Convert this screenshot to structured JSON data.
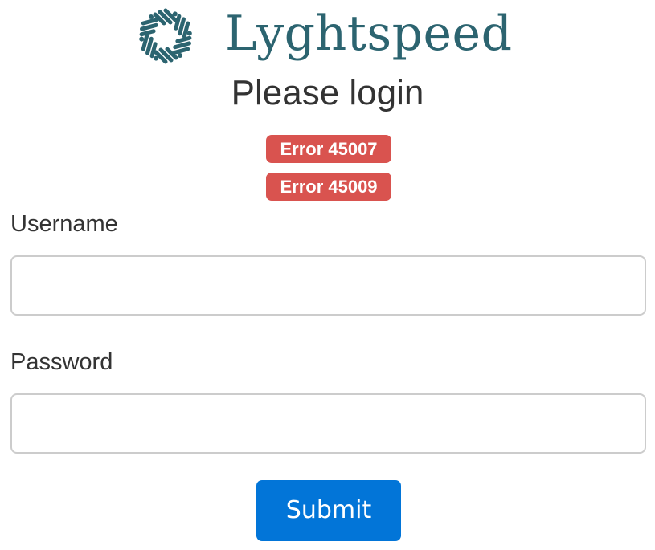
{
  "brand": {
    "name": "Lyghtspeed",
    "logo_icon": "circuit-ring-logo",
    "color": "#2c6470"
  },
  "title": "Please login",
  "errors": [
    {
      "text": "Error 45007"
    },
    {
      "text": "Error 45009"
    }
  ],
  "form": {
    "username": {
      "label": "Username",
      "value": "",
      "placeholder": ""
    },
    "password": {
      "label": "Password",
      "value": "",
      "placeholder": ""
    },
    "submit_label": "Submit"
  },
  "colors": {
    "error_badge": "#d9534f",
    "submit_button": "#0275d8",
    "text": "#333333"
  }
}
